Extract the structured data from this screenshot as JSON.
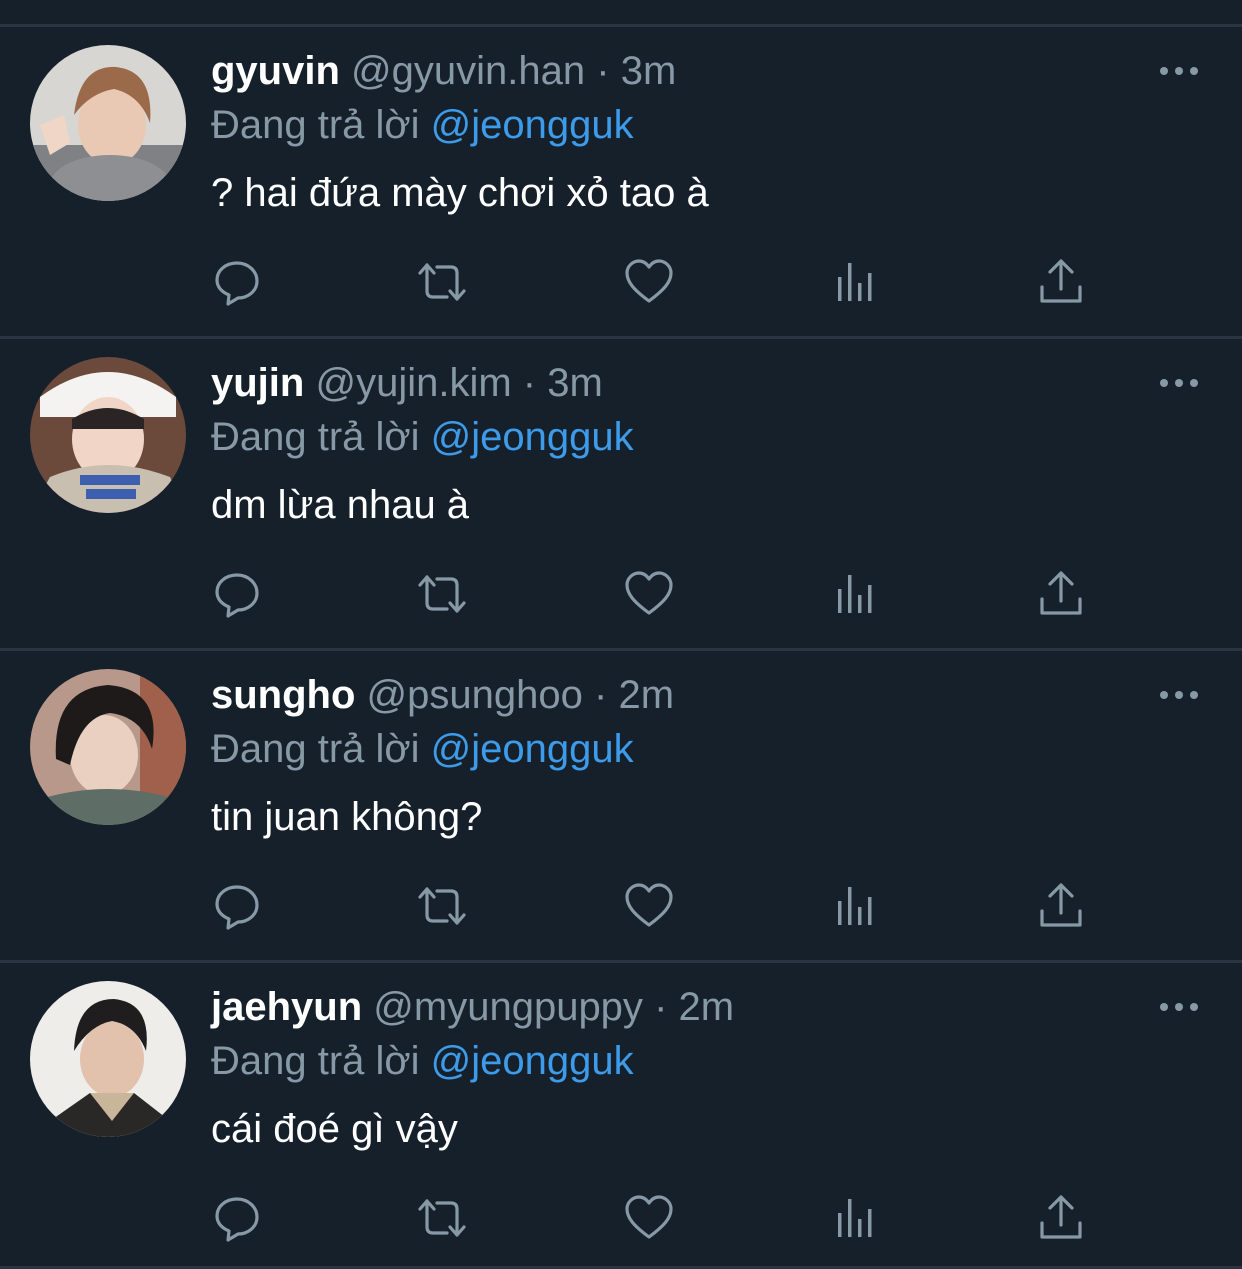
{
  "colors": {
    "background": "#15202b",
    "divider": "#2a3541",
    "muted_text": "#8899a6",
    "mention": "#3d9be9",
    "primary_text": "#ffffff"
  },
  "replying_prefix": "Đang trả lời",
  "tweets": [
    {
      "display_name": "gyuvin",
      "handle": "@gyuvin.han",
      "separator": "·",
      "time": "3m",
      "reply_to": "@jeongguk",
      "text": "? hai đứa mày chơi xỏ tao à",
      "avatar_icon": "avatar-photo"
    },
    {
      "display_name": "yujin",
      "handle": "@yujin.kim",
      "separator": "·",
      "time": "3m",
      "reply_to": "@jeongguk",
      "text": "dm lừa nhau à",
      "avatar_icon": "avatar-photo"
    },
    {
      "display_name": "sungho",
      "handle": "@psunghoo",
      "separator": "·",
      "time": "2m",
      "reply_to": "@jeongguk",
      "text": "tin juan không?",
      "avatar_icon": "avatar-photo"
    },
    {
      "display_name": "jaehyun",
      "handle": "@myungpuppy",
      "separator": "·",
      "time": "2m",
      "reply_to": "@jeongguk",
      "text": "cái đoé gì vậy",
      "avatar_icon": "avatar-photo"
    }
  ],
  "action_icons": [
    "reply-icon",
    "retweet-icon",
    "like-icon",
    "views-icon",
    "share-icon"
  ]
}
